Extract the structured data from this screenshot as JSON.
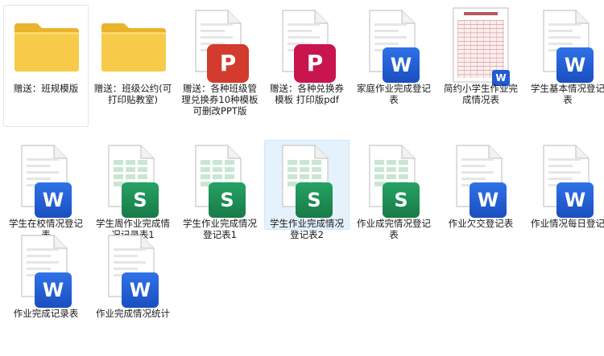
{
  "files": [
    {
      "label": "赠送：班规模版",
      "type": "folder"
    },
    {
      "label": "赠送：班级公约(可打印贴教室)",
      "type": "folder"
    },
    {
      "label": "赠送：各种班级管理兑换券10种模板 可删改PPT版",
      "type": "ppt",
      "badge": "P"
    },
    {
      "label": "赠送：各种兑换券模板 打印版pdf",
      "type": "pdf",
      "badge": "P"
    },
    {
      "label": "家庭作业完成登记表",
      "type": "word",
      "badge": "W"
    },
    {
      "label": "简约小学生作业完成情况表",
      "type": "thumbnail",
      "badge": "W"
    },
    {
      "label": "学生基本情况登记表",
      "type": "word",
      "badge": "W"
    },
    {
      "label": "学生在校情况登记表",
      "type": "word",
      "badge": "W"
    },
    {
      "label": "学生周作业完成情况记录表1",
      "type": "excel",
      "badge": "S"
    },
    {
      "label": "学生作业完成情况登记表1",
      "type": "excel",
      "badge": "S"
    },
    {
      "label": "学生作业完成情况登记表2",
      "type": "excel",
      "badge": "S",
      "selected": true
    },
    {
      "label": "作业成完情况登记表",
      "type": "excel",
      "badge": "S"
    },
    {
      "label": "作业欠交登记表",
      "type": "word",
      "badge": "W"
    },
    {
      "label": "作业情况每日登记",
      "type": "word",
      "badge": "W"
    },
    {
      "label": "作业完成记录表",
      "type": "word",
      "badge": "W"
    },
    {
      "label": "作业完成情况统计",
      "type": "word",
      "badge": "W"
    }
  ],
  "colors": {
    "word": "#1f5dd0",
    "excel": "#1e8a52",
    "ppt": "#d23b2d",
    "pdf": "#c9154e",
    "folder": "#f5c642",
    "selection": "#e5f1fb"
  }
}
